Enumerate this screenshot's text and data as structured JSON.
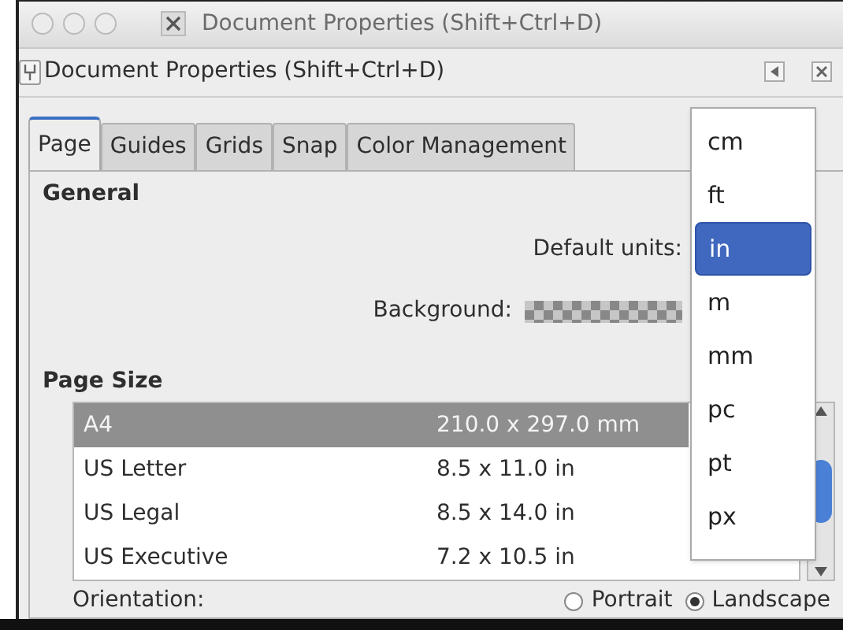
{
  "window": {
    "title": "Document Properties (Shift+Ctrl+D)"
  },
  "dock": {
    "title": "Document Properties (Shift+Ctrl+D)"
  },
  "tabs": [
    {
      "label": "Page",
      "selected": true
    },
    {
      "label": "Guides",
      "selected": false
    },
    {
      "label": "Grids",
      "selected": false
    },
    {
      "label": "Snap",
      "selected": false
    },
    {
      "label": "Color Management",
      "selected": false
    }
  ],
  "general": {
    "heading": "General",
    "default_units_label": "Default units:",
    "background_label": "Background:"
  },
  "page_size": {
    "heading": "Page Size",
    "rows": [
      {
        "name": "A4",
        "size": "210.0 x 297.0 mm",
        "selected": true
      },
      {
        "name": "US Letter",
        "size": "8.5 x 11.0 in",
        "selected": false
      },
      {
        "name": "US Legal",
        "size": "8.5 x 14.0 in",
        "selected": false
      },
      {
        "name": "US Executive",
        "size": "7.2 x 10.5 in",
        "selected": false
      }
    ]
  },
  "orientation": {
    "label": "Orientation:",
    "options": [
      {
        "label": "Portrait",
        "selected": false
      },
      {
        "label": "Landscape",
        "selected": true
      }
    ]
  },
  "units_menu": {
    "options": [
      {
        "label": "cm",
        "selected": false
      },
      {
        "label": "ft",
        "selected": false
      },
      {
        "label": "in",
        "selected": true
      },
      {
        "label": "m",
        "selected": false
      },
      {
        "label": "mm",
        "selected": false
      },
      {
        "label": "pc",
        "selected": false
      },
      {
        "label": "pt",
        "selected": false
      },
      {
        "label": "px",
        "selected": false
      }
    ]
  }
}
